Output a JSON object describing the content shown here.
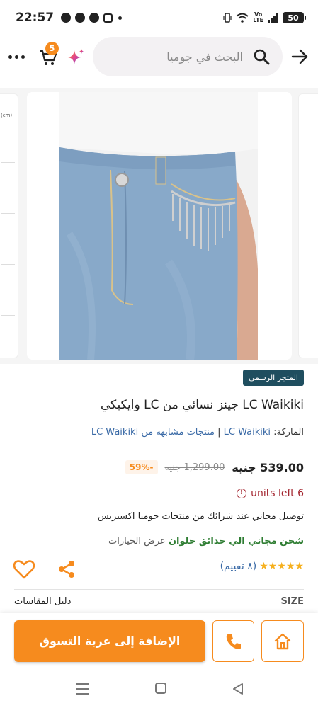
{
  "status_bar": {
    "time": "22:57",
    "battery": "50",
    "network": "Vo LTE"
  },
  "header": {
    "search_placeholder": "البحث في جوميا",
    "cart_count": "5",
    "icons": [
      "back-arrow-icon",
      "search-icon",
      "sparkle-icon",
      "cart-icon",
      "more-icon"
    ]
  },
  "gallery": {
    "size_chart_unit": "(cm)"
  },
  "product": {
    "official_store_badge": "المتجر الرسمي",
    "title": "LC Waikiki جينز نسائي من LC وايكيكي",
    "brand_label": "الماركة:",
    "brand_name": "LC Waikiki",
    "similar_prefix": "منتجات مشابهه من",
    "similar_brand": "LC Waikiki",
    "price": "539.00 جنيه",
    "old_price": "1,299.00 جنيه",
    "discount": "-59%",
    "units_left": "units left 6",
    "express_text": "توصيل مجاني عند شرائك من منتجات جوميا اكسبريس",
    "shipping_text": "شحن مجاني الي حدائق حلوان",
    "shipping_options": "عرض الخيارات",
    "rating_stars": 4.5,
    "rating_count": "(٨ تقييم)",
    "size_label": "SIZE",
    "size_guide": "دليل المقاسات"
  },
  "actions": {
    "add_to_cart": "الإضافة إلى عربة التسوق"
  },
  "colors": {
    "accent": "#f68b1e",
    "badge": "#1f4e5f",
    "link": "#3a6aa6",
    "units_left": "#a3242e",
    "shipping_green": "#2e7d32",
    "star": "#f6b01e"
  }
}
